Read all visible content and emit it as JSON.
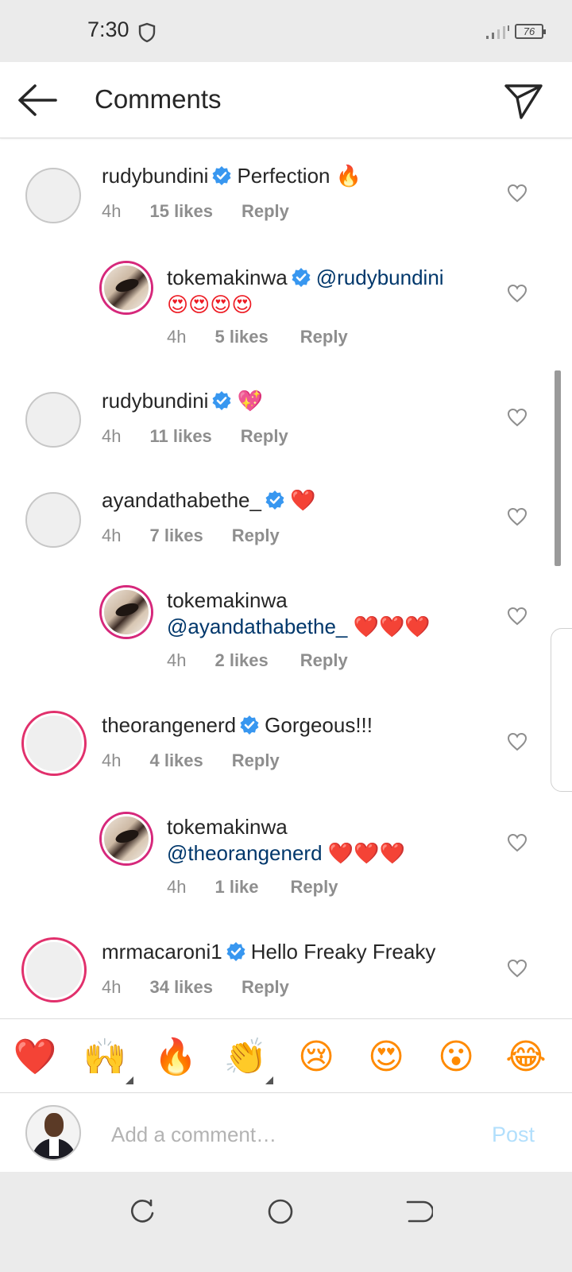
{
  "status_bar": {
    "time": "7:30",
    "battery": "76"
  },
  "header": {
    "title": "Comments"
  },
  "comments": [
    {
      "username": "rudybundini",
      "verified": true,
      "text": "Perfection ",
      "emoji": "🔥",
      "time": "4h",
      "likes": "15 likes",
      "reply": "Reply"
    },
    {
      "username": "tokemakinwa",
      "verified": true,
      "mention": "@rudybundini",
      "emoji": "😍😍😍😍",
      "time": "4h",
      "likes": "5 likes",
      "reply": "Reply"
    },
    {
      "username": "rudybundini",
      "verified": true,
      "emoji": "💖",
      "time": "4h",
      "likes": "11 likes",
      "reply": "Reply"
    },
    {
      "username": "ayandathabethe_",
      "verified": true,
      "emoji": "❤️",
      "time": "4h",
      "likes": "7 likes",
      "reply": "Reply"
    },
    {
      "username": "tokemakinwa",
      "verified": false,
      "mention": "@ayandathabethe_",
      "emoji": "❤️❤️❤️",
      "time": "4h",
      "likes": "2 likes",
      "reply": "Reply"
    },
    {
      "username": "theorangenerd",
      "verified": true,
      "text": "Gorgeous!!!",
      "time": "4h",
      "likes": "4 likes",
      "reply": "Reply"
    },
    {
      "username": "tokemakinwa",
      "verified": false,
      "mention": "@theorangenerd",
      "emoji": "❤️❤️❤️",
      "time": "4h",
      "likes": "1 like",
      "reply": "Reply"
    },
    {
      "username": "mrmacaroni1",
      "verified": true,
      "text": "Hello Freaky Freaky",
      "time": "4h",
      "likes": "34 likes",
      "reply": "Reply"
    }
  ],
  "emoji_bar": [
    "❤️",
    "🙌",
    "🔥",
    "👏",
    "😢",
    "😍",
    "😮",
    "😂"
  ],
  "composer": {
    "placeholder": "Add a comment…",
    "post_label": "Post"
  },
  "colors": {
    "accent_blue": "#0095f6",
    "post_disabled": "#b2dffc",
    "mention": "#00376b",
    "story_ring": "#e1306c"
  }
}
